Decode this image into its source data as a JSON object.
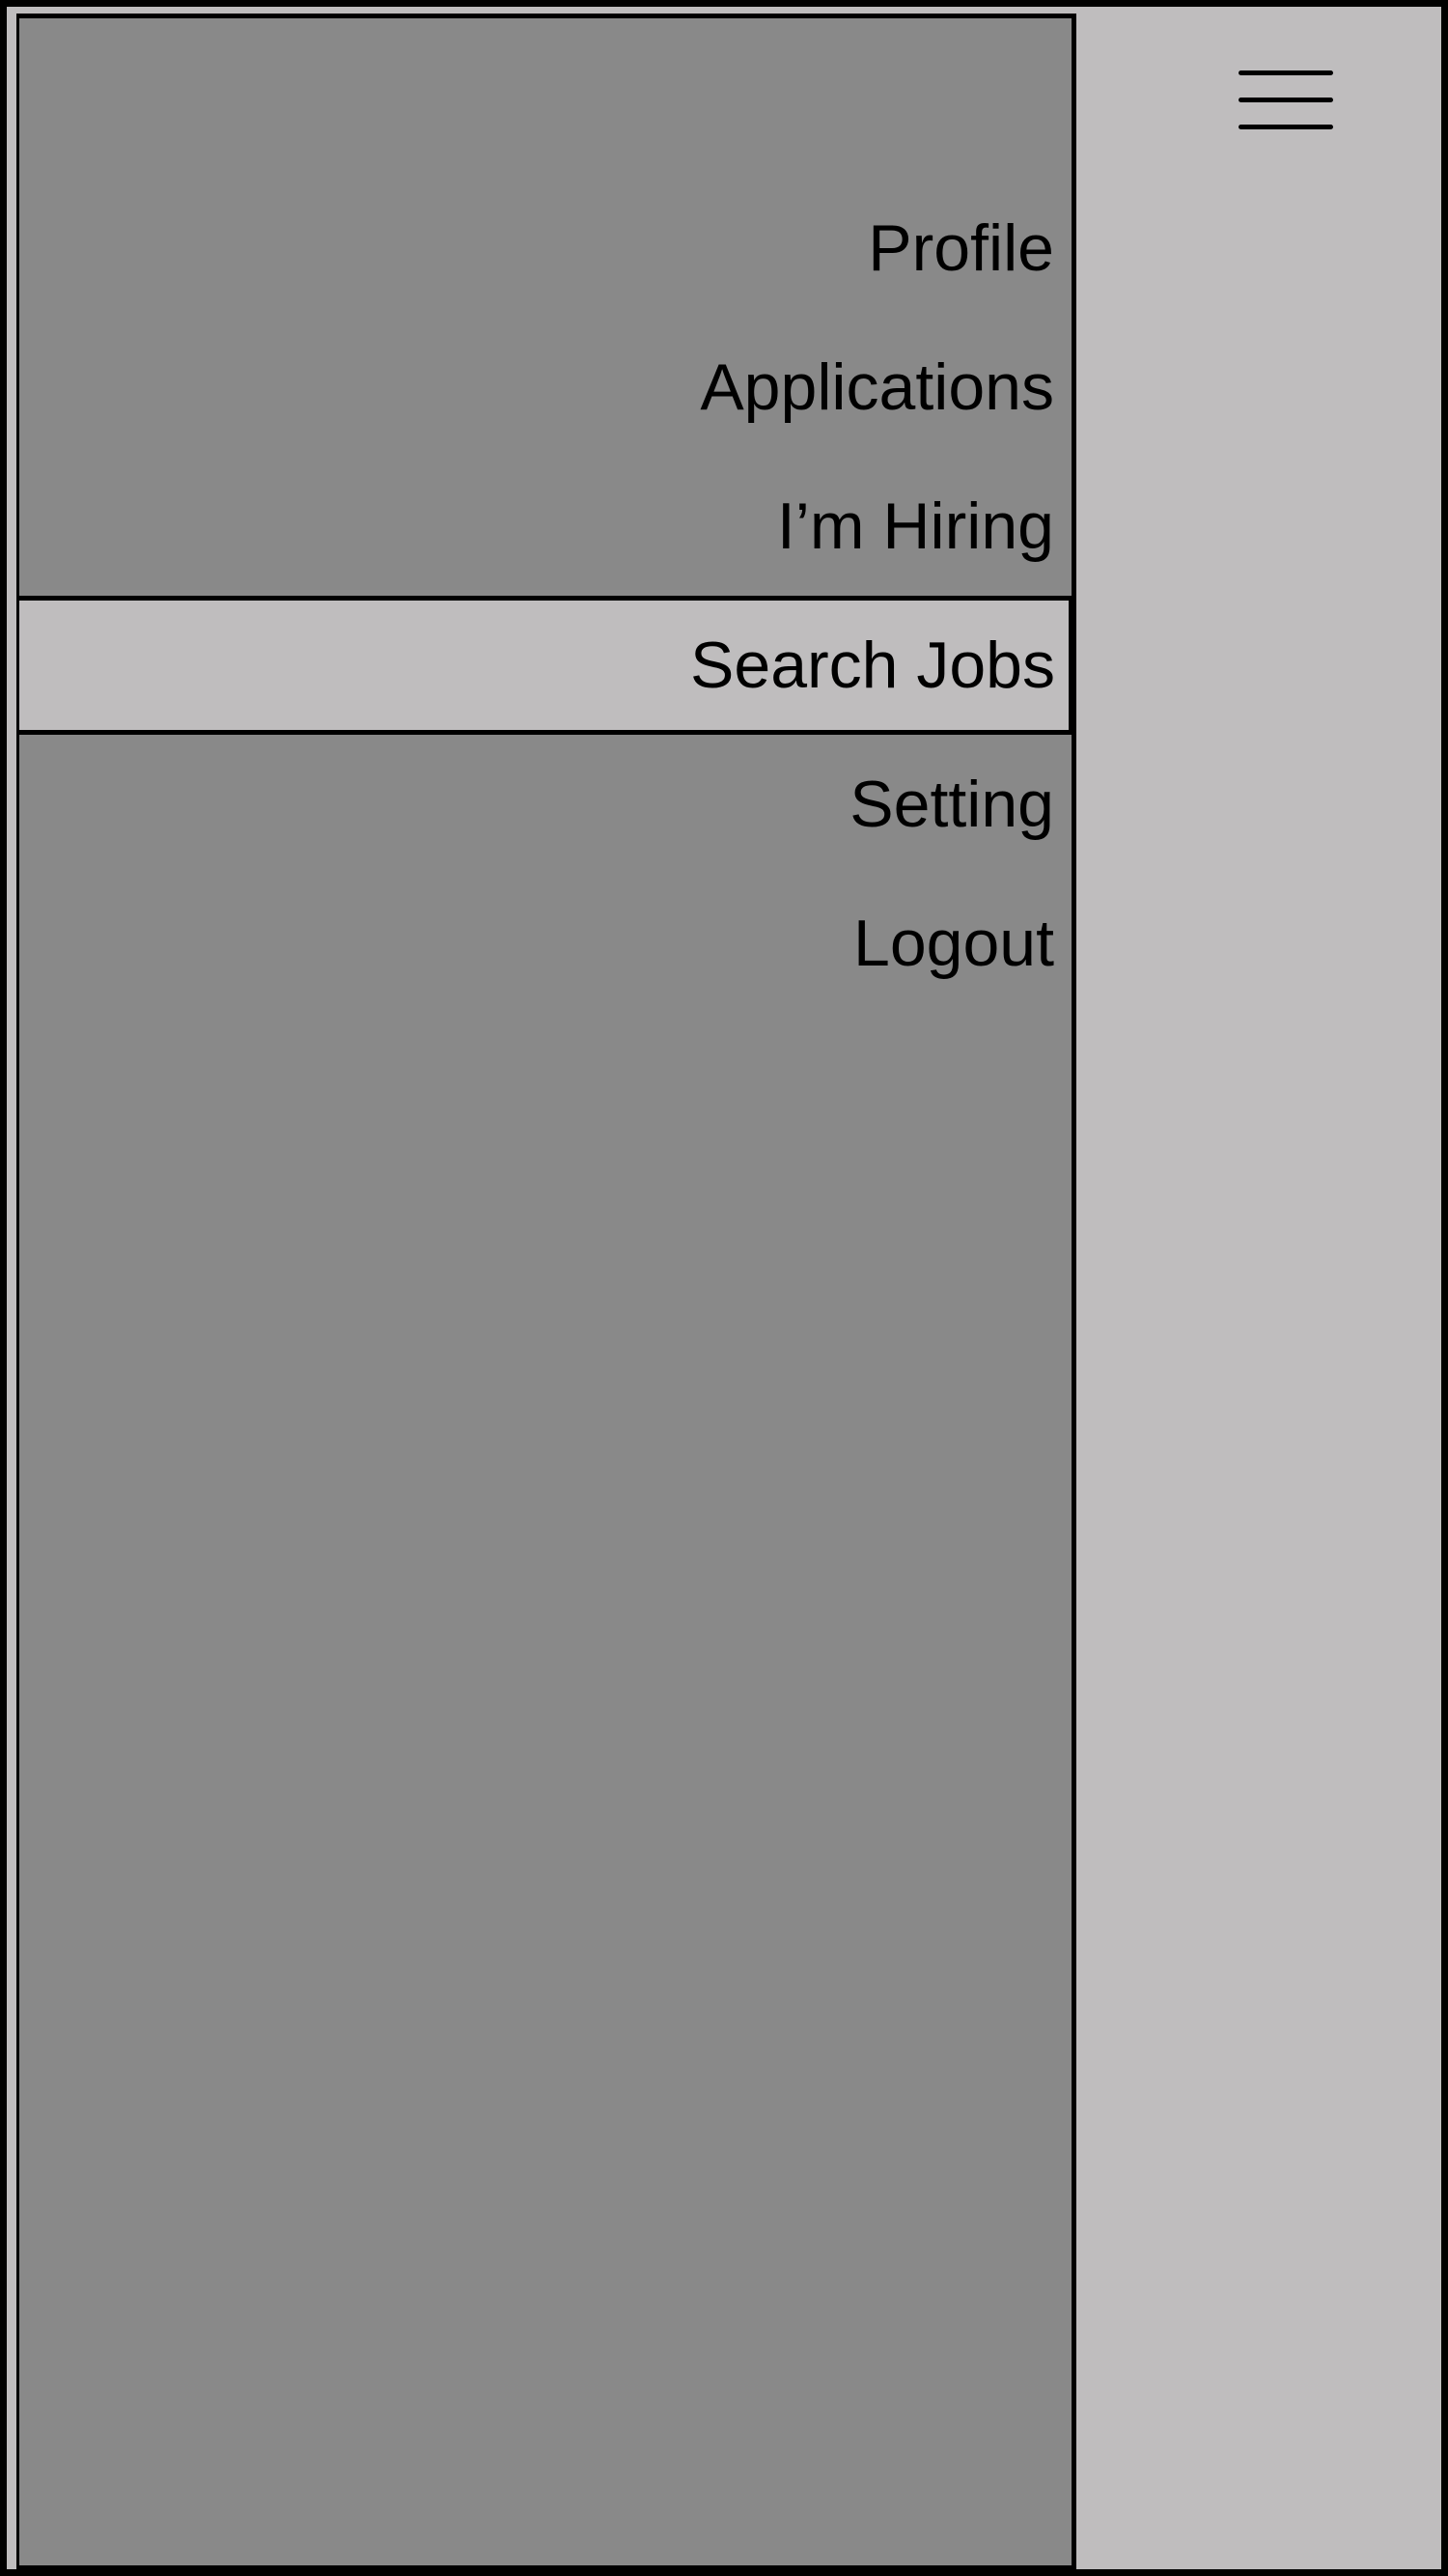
{
  "menu": {
    "items": [
      {
        "label": "Profile",
        "active": false
      },
      {
        "label": "Applications",
        "active": false
      },
      {
        "label": "I’m Hiring",
        "active": false
      },
      {
        "label": "Search Jobs",
        "active": true
      },
      {
        "label": "Setting",
        "active": false
      },
      {
        "label": "Logout",
        "active": false
      }
    ]
  },
  "header": {
    "menu_icon": "hamburger-menu-icon"
  },
  "colors": {
    "drawer_background": "#898989",
    "content_background": "#bfbdbe",
    "active_item_background": "#bfbdbe",
    "border": "#000000",
    "text": "#000000"
  }
}
